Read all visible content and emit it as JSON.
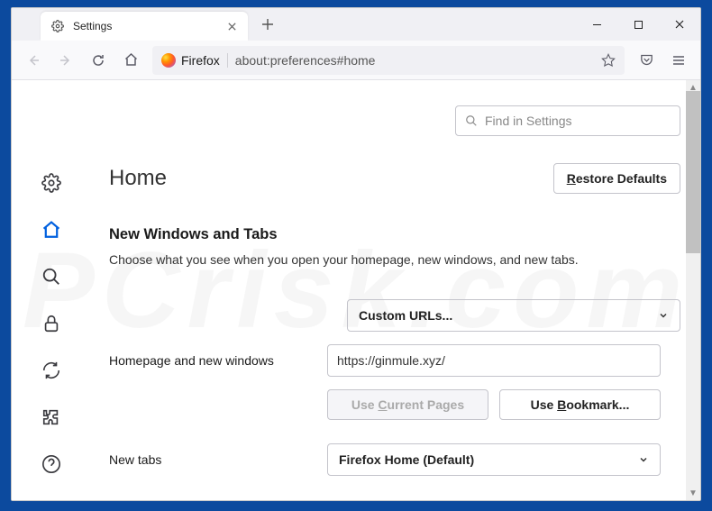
{
  "window": {
    "tab_title": "Settings",
    "newtab_tooltip": "+"
  },
  "urlbar": {
    "identity": "Firefox",
    "url": "about:preferences#home"
  },
  "search": {
    "placeholder": "Find in Settings"
  },
  "page": {
    "title": "Home",
    "restore_defaults": "Restore Defaults",
    "section_title": "New Windows and Tabs",
    "section_desc": "Choose what you see when you open your homepage, new windows, and new tabs.",
    "homepage_label": "Homepage and new windows",
    "homepage_mode": "Custom URLs...",
    "homepage_value": "https://ginmule.xyz/",
    "use_current": "Use Current Pages",
    "use_bookmark": "Use Bookmark...",
    "newtabs_label": "New tabs",
    "newtabs_mode": "Firefox Home (Default)"
  }
}
